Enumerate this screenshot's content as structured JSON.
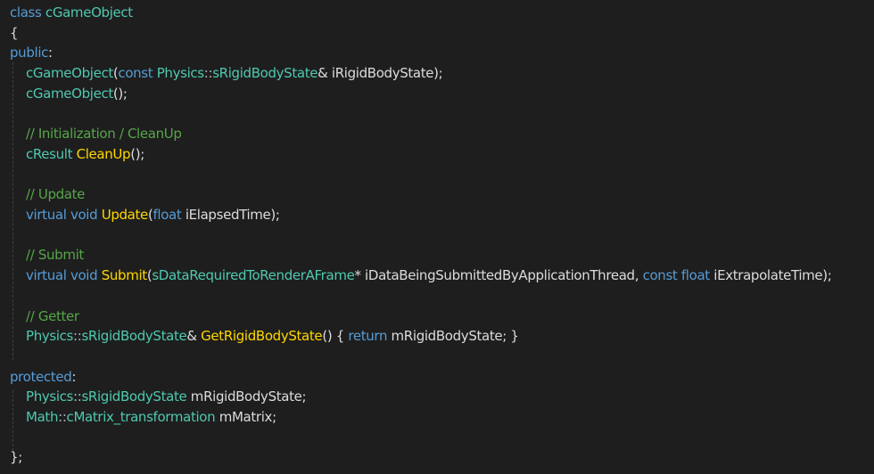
{
  "editor": {
    "lines": [
      {
        "tokens": [
          {
            "t": "class",
            "c": "kw"
          },
          {
            "t": " ",
            "c": "id"
          },
          {
            "t": "cGameObject",
            "c": "cls"
          }
        ]
      },
      {
        "tokens": [
          {
            "t": "{",
            "c": "id"
          }
        ]
      },
      {
        "tokens": [
          {
            "t": "public",
            "c": "kw"
          },
          {
            "t": ":",
            "c": "id"
          }
        ]
      },
      {
        "indent": true,
        "tokens": [
          {
            "t": "cGameObject",
            "c": "cls"
          },
          {
            "t": "(",
            "c": "id"
          },
          {
            "t": "const",
            "c": "kw"
          },
          {
            "t": " ",
            "c": "id"
          },
          {
            "t": "Physics",
            "c": "cls"
          },
          {
            "t": "::",
            "c": "op"
          },
          {
            "t": "sRigidBodyState",
            "c": "cls"
          },
          {
            "t": "& iRigidBodyState);",
            "c": "id"
          }
        ]
      },
      {
        "indent": true,
        "tokens": [
          {
            "t": "cGameObject",
            "c": "cls"
          },
          {
            "t": "();",
            "c": "id"
          }
        ]
      },
      {
        "tokens": []
      },
      {
        "indent": true,
        "tokens": [
          {
            "t": "// Initialization / CleanUp",
            "c": "cm"
          }
        ]
      },
      {
        "indent": true,
        "tokens": [
          {
            "t": "cResult",
            "c": "cls"
          },
          {
            "t": " ",
            "c": "id"
          },
          {
            "t": "CleanUp",
            "c": "fnh"
          },
          {
            "t": "();",
            "c": "id"
          }
        ]
      },
      {
        "tokens": []
      },
      {
        "indent": true,
        "tokens": [
          {
            "t": "// Update",
            "c": "cm"
          }
        ]
      },
      {
        "indent": true,
        "tokens": [
          {
            "t": "virtual",
            "c": "kw"
          },
          {
            "t": " ",
            "c": "id"
          },
          {
            "t": "void",
            "c": "kw"
          },
          {
            "t": " ",
            "c": "id"
          },
          {
            "t": "Update",
            "c": "fnh"
          },
          {
            "t": "(",
            "c": "id"
          },
          {
            "t": "float",
            "c": "kw"
          },
          {
            "t": " iElapsedTime);",
            "c": "id"
          }
        ]
      },
      {
        "tokens": []
      },
      {
        "indent": true,
        "tokens": [
          {
            "t": "// Submit",
            "c": "cm"
          }
        ]
      },
      {
        "indent": true,
        "tokens": [
          {
            "t": "virtual",
            "c": "kw"
          },
          {
            "t": " ",
            "c": "id"
          },
          {
            "t": "void",
            "c": "kw"
          },
          {
            "t": " ",
            "c": "id"
          },
          {
            "t": "Submit",
            "c": "fnh"
          },
          {
            "t": "(",
            "c": "id"
          },
          {
            "t": "sDataRequiredToRenderAFrame",
            "c": "cls"
          },
          {
            "t": "* iDataBeingSubmittedByApplicationThread, ",
            "c": "id"
          },
          {
            "t": "const",
            "c": "kw"
          },
          {
            "t": " ",
            "c": "id"
          },
          {
            "t": "float",
            "c": "kw"
          },
          {
            "t": " iExtrapolateTime);",
            "c": "id"
          }
        ]
      },
      {
        "tokens": []
      },
      {
        "indent": true,
        "tokens": [
          {
            "t": "// Getter",
            "c": "cm"
          }
        ]
      },
      {
        "indent": true,
        "tokens": [
          {
            "t": "Physics",
            "c": "cls"
          },
          {
            "t": "::",
            "c": "op"
          },
          {
            "t": "sRigidBodyState",
            "c": "cls"
          },
          {
            "t": "& ",
            "c": "id"
          },
          {
            "t": "GetRigidBodyState",
            "c": "fnh"
          },
          {
            "t": "() { ",
            "c": "id"
          },
          {
            "t": "return",
            "c": "kw"
          },
          {
            "t": " mRigidBodyState; }",
            "c": "id"
          }
        ]
      },
      {
        "tokens": []
      },
      {
        "tokens": [
          {
            "t": "protected",
            "c": "kw"
          },
          {
            "t": ":",
            "c": "id"
          }
        ]
      },
      {
        "indent": true,
        "tokens": [
          {
            "t": "Physics",
            "c": "cls"
          },
          {
            "t": "::",
            "c": "op"
          },
          {
            "t": "sRigidBodyState",
            "c": "cls"
          },
          {
            "t": " mRigidBodyState;",
            "c": "id"
          }
        ]
      },
      {
        "indent": true,
        "tokens": [
          {
            "t": "Math",
            "c": "cls"
          },
          {
            "t": "::",
            "c": "op"
          },
          {
            "t": "cMatrix_transformation",
            "c": "cls"
          },
          {
            "t": " mMatrix;",
            "c": "id"
          }
        ]
      },
      {
        "tokens": []
      },
      {
        "tokens": [
          {
            "t": "};",
            "c": "id"
          }
        ]
      }
    ]
  }
}
